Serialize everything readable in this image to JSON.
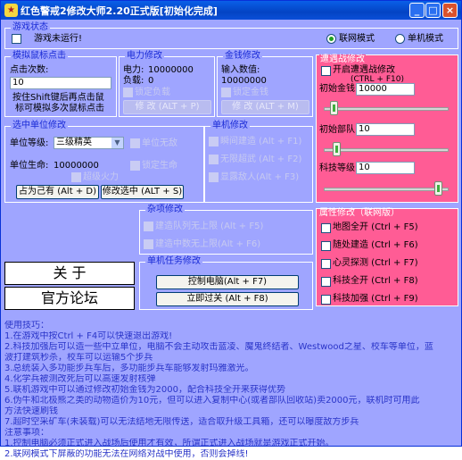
{
  "window": {
    "title": "红色警戒2修改大师2.20正式版[初始化完成]",
    "minimize": "_",
    "maximize": "□",
    "close": "×"
  },
  "game_status": {
    "label": "游戏状态",
    "status_text": "游戏未运行!",
    "mode_online": "联网模式",
    "mode_single": "单机模式",
    "selected_mode": "联网模式"
  },
  "mouse": {
    "label": "模拟鼠标点击",
    "count_label": "点击次数:",
    "count_value": "10",
    "hint_line1": "按住Shift键后再点击鼠",
    "hint_line2": "标可模拟多次鼠标点击"
  },
  "power": {
    "label": "电力修改",
    "power_label": "电力:",
    "power_value": "10000000",
    "load_label": "负载:",
    "load_value": "0",
    "lock_label": "锁定负载",
    "button": "修 改 (ALT + P)"
  },
  "money": {
    "label": "金钱修改",
    "input_label": "输入数值:",
    "input_value": "10000000",
    "lock_label": "锁定金钱",
    "button": "修 改 (ALT + M)"
  },
  "hegemony": {
    "label": "遭遇战修改",
    "enable_label": "开启遭遇战修改",
    "enable_hotkey": "(CTRL + F10)",
    "initial_money_label": "初始金钱",
    "initial_money_value": "10000",
    "initial_money_slider": 0.05,
    "initial_units_label": "初始部队",
    "initial_units_value": "10",
    "initial_units_slider": 0.08,
    "tech_label": "科技等级",
    "tech_value": "10",
    "tech_slider": 0.95
  },
  "selected_unit": {
    "label": "选中单位修改",
    "level_label": "单位等级:",
    "level_value": "三级精英",
    "invincible_label": "单位无敌",
    "life_label": "单位生命:",
    "life_value": "10000000",
    "lock_life_label": "锁定生命",
    "super_fire_label": "超级火力",
    "occupy_button": "占为己有 (Alt + D)",
    "modify_button": "修改选中 (ALT + S)"
  },
  "single_mode": {
    "label": "单机修改",
    "items": [
      {
        "label": "瞬间建造 (Alt + F1)"
      },
      {
        "label": "无限超武 (Alt + F2)"
      },
      {
        "label": "显露敌人(Alt + F3)"
      }
    ]
  },
  "misc": {
    "label": "杂项修改",
    "items": [
      {
        "label": "建造队列无上限 (Alt + F5)"
      },
      {
        "label": "建造中数无上限(Alt + F6)"
      }
    ]
  },
  "attributes": {
    "label": "属性修改（联网版）",
    "items": [
      {
        "label": "地图全开 (Ctrl + F5)"
      },
      {
        "label": "随处建造 (Ctrl + F6)"
      },
      {
        "label": "心灵探测 (Ctrl + F7)"
      },
      {
        "label": "科技全开 (Ctrl + F8)"
      },
      {
        "label": "科技加强 (Ctrl + F9)"
      }
    ]
  },
  "close_button": "关  于",
  "forum_button": "官方论坛",
  "mission": {
    "label": "单机任务修改",
    "control_button": "控制电脑(Alt + F7)",
    "win_button": "立即过关 (Alt + F8)"
  },
  "tips": [
    "使用技巧：",
    "1.在游戏中按Ctrl + F4可以快速退出游戏!",
    "2.科技加强后可以造一些中立单位，电脑不会主动攻击蓝凌、魔鬼终结者、Westwood之星、校车等单位，蓝",
    "波打建筑秒杀，校车可以运输5个步兵",
    "3.总统装入多功能步兵车后，多功能步兵车能够发射玛雅激光。",
    "4.化学兵被测改死后可以高速发射核弹",
    "5.联机游戏中可以通过修改初始金钱为2000，配合科技全开来获得优势",
    "6.伪牛和北极熊之类的动物造价为10元，但可以进入复制中心(或者部队回收站)卖2000元，联机时可用此",
    "方法快速刷钱",
    "7.超时空采矿车(未装载)可以无法结地无限传送，适合取升级工具箱，还可以曝度敌方步兵",
    "注意事项：",
    "1.控制电脑必须正式进入战场后使用才有效，所谓正式进入战场就是游戏正式开始。",
    "2.联网模式下屏蔽的功能无法在网络对战中使用，否则会掉线!"
  ]
}
